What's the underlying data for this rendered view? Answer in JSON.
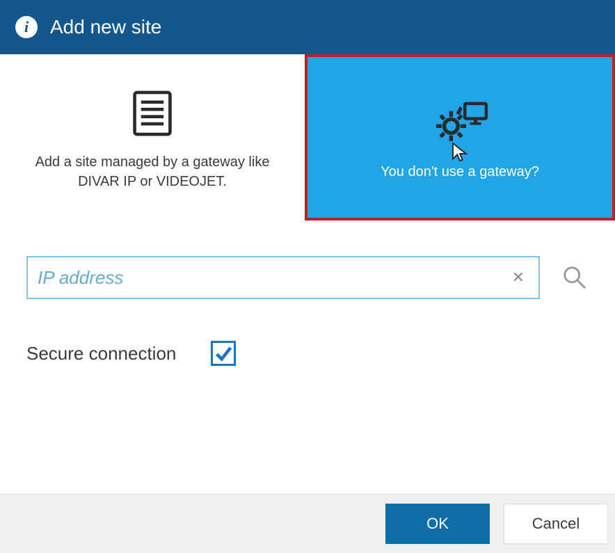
{
  "titlebar": {
    "icon_glyph": "i",
    "title": "Add new site"
  },
  "options": {
    "gateway": {
      "text": "Add a site managed by a gateway like DIVAR IP or VIDEOJET."
    },
    "no_gateway": {
      "text": "You don't use a gateway?"
    }
  },
  "ip": {
    "placeholder": "IP address",
    "value": ""
  },
  "secure": {
    "label": "Secure connection",
    "checked": true
  },
  "footer": {
    "ok": "OK",
    "cancel": "Cancel"
  }
}
